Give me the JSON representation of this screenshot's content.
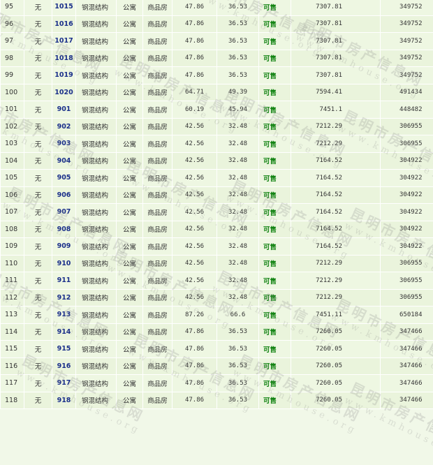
{
  "watermark": {
    "cn": "昆明市房产信息网",
    "en": "www.kmhouse.org"
  },
  "rows": [
    {
      "seq": "95",
      "flag": "无",
      "room": "1015",
      "structure": "钢混结构",
      "use": "公寓",
      "type": "商品房",
      "area": "47.86",
      "inner_area": "36.53",
      "status": "可售",
      "unit_price": "7307.81",
      "total": "349752"
    },
    {
      "seq": "96",
      "flag": "无",
      "room": "1016",
      "structure": "钢混结构",
      "use": "公寓",
      "type": "商品房",
      "area": "47.86",
      "inner_area": "36.53",
      "status": "可售",
      "unit_price": "7307.81",
      "total": "349752"
    },
    {
      "seq": "97",
      "flag": "无",
      "room": "1017",
      "structure": "钢混结构",
      "use": "公寓",
      "type": "商品房",
      "area": "47.86",
      "inner_area": "36.53",
      "status": "可售",
      "unit_price": "7307.81",
      "total": "349752"
    },
    {
      "seq": "98",
      "flag": "无",
      "room": "1018",
      "structure": "钢混结构",
      "use": "公寓",
      "type": "商品房",
      "area": "47.86",
      "inner_area": "36.53",
      "status": "可售",
      "unit_price": "7307.81",
      "total": "349752"
    },
    {
      "seq": "99",
      "flag": "无",
      "room": "1019",
      "structure": "钢混结构",
      "use": "公寓",
      "type": "商品房",
      "area": "47.86",
      "inner_area": "36.53",
      "status": "可售",
      "unit_price": "7307.81",
      "total": "349752"
    },
    {
      "seq": "100",
      "flag": "无",
      "room": "1020",
      "structure": "钢混结构",
      "use": "公寓",
      "type": "商品房",
      "area": "64.71",
      "inner_area": "49.39",
      "status": "可售",
      "unit_price": "7594.41",
      "total": "491434"
    },
    {
      "seq": "101",
      "flag": "无",
      "room": "901",
      "structure": "钢混结构",
      "use": "公寓",
      "type": "商品房",
      "area": "60.19",
      "inner_area": "45.94",
      "status": "可售",
      "unit_price": "7451.1",
      "total": "448482"
    },
    {
      "seq": "102",
      "flag": "无",
      "room": "902",
      "structure": "钢混结构",
      "use": "公寓",
      "type": "商品房",
      "area": "42.56",
      "inner_area": "32.48",
      "status": "可售",
      "unit_price": "7212.29",
      "total": "306955"
    },
    {
      "seq": "103",
      "flag": "无",
      "room": "903",
      "structure": "钢混结构",
      "use": "公寓",
      "type": "商品房",
      "area": "42.56",
      "inner_area": "32.48",
      "status": "可售",
      "unit_price": "7212.29",
      "total": "306955"
    },
    {
      "seq": "104",
      "flag": "无",
      "room": "904",
      "structure": "钢混结构",
      "use": "公寓",
      "type": "商品房",
      "area": "42.56",
      "inner_area": "32.48",
      "status": "可售",
      "unit_price": "7164.52",
      "total": "304922"
    },
    {
      "seq": "105",
      "flag": "无",
      "room": "905",
      "structure": "钢混结构",
      "use": "公寓",
      "type": "商品房",
      "area": "42.56",
      "inner_area": "32.48",
      "status": "可售",
      "unit_price": "7164.52",
      "total": "304922"
    },
    {
      "seq": "106",
      "flag": "无",
      "room": "906",
      "structure": "钢混结构",
      "use": "公寓",
      "type": "商品房",
      "area": "42.56",
      "inner_area": "32.48",
      "status": "可售",
      "unit_price": "7164.52",
      "total": "304922"
    },
    {
      "seq": "107",
      "flag": "无",
      "room": "907",
      "structure": "钢混结构",
      "use": "公寓",
      "type": "商品房",
      "area": "42.56",
      "inner_area": "32.48",
      "status": "可售",
      "unit_price": "7164.52",
      "total": "304922"
    },
    {
      "seq": "108",
      "flag": "无",
      "room": "908",
      "structure": "钢混结构",
      "use": "公寓",
      "type": "商品房",
      "area": "42.56",
      "inner_area": "32.48",
      "status": "可售",
      "unit_price": "7164.52",
      "total": "304922"
    },
    {
      "seq": "109",
      "flag": "无",
      "room": "909",
      "structure": "钢混结构",
      "use": "公寓",
      "type": "商品房",
      "area": "42.56",
      "inner_area": "32.48",
      "status": "可售",
      "unit_price": "7164.52",
      "total": "304922"
    },
    {
      "seq": "110",
      "flag": "无",
      "room": "910",
      "structure": "钢混结构",
      "use": "公寓",
      "type": "商品房",
      "area": "42.56",
      "inner_area": "32.48",
      "status": "可售",
      "unit_price": "7212.29",
      "total": "306955"
    },
    {
      "seq": "111",
      "flag": "无",
      "room": "911",
      "structure": "钢混结构",
      "use": "公寓",
      "type": "商品房",
      "area": "42.56",
      "inner_area": "32.48",
      "status": "可售",
      "unit_price": "7212.29",
      "total": "306955"
    },
    {
      "seq": "112",
      "flag": "无",
      "room": "912",
      "structure": "钢混结构",
      "use": "公寓",
      "type": "商品房",
      "area": "42.56",
      "inner_area": "32.48",
      "status": "可售",
      "unit_price": "7212.29",
      "total": "306955"
    },
    {
      "seq": "113",
      "flag": "无",
      "room": "913",
      "structure": "钢混结构",
      "use": "公寓",
      "type": "商品房",
      "area": "87.26",
      "inner_area": "66.6",
      "status": "可售",
      "unit_price": "7451.11",
      "total": "650184"
    },
    {
      "seq": "114",
      "flag": "无",
      "room": "914",
      "structure": "钢混结构",
      "use": "公寓",
      "type": "商品房",
      "area": "47.86",
      "inner_area": "36.53",
      "status": "可售",
      "unit_price": "7260.05",
      "total": "347466"
    },
    {
      "seq": "115",
      "flag": "无",
      "room": "915",
      "structure": "钢混结构",
      "use": "公寓",
      "type": "商品房",
      "area": "47.86",
      "inner_area": "36.53",
      "status": "可售",
      "unit_price": "7260.05",
      "total": "347466"
    },
    {
      "seq": "116",
      "flag": "无",
      "room": "916",
      "structure": "钢混结构",
      "use": "公寓",
      "type": "商品房",
      "area": "47.86",
      "inner_area": "36.53",
      "status": "可售",
      "unit_price": "7260.05",
      "total": "347466"
    },
    {
      "seq": "117",
      "flag": "无",
      "room": "917",
      "structure": "钢混结构",
      "use": "公寓",
      "type": "商品房",
      "area": "47.86",
      "inner_area": "36.53",
      "status": "可售",
      "unit_price": "7260.05",
      "total": "347466"
    },
    {
      "seq": "118",
      "flag": "无",
      "room": "918",
      "structure": "钢混结构",
      "use": "公寓",
      "type": "商品房",
      "area": "47.86",
      "inner_area": "36.53",
      "status": "可售",
      "unit_price": "7260.05",
      "total": "347466"
    }
  ]
}
